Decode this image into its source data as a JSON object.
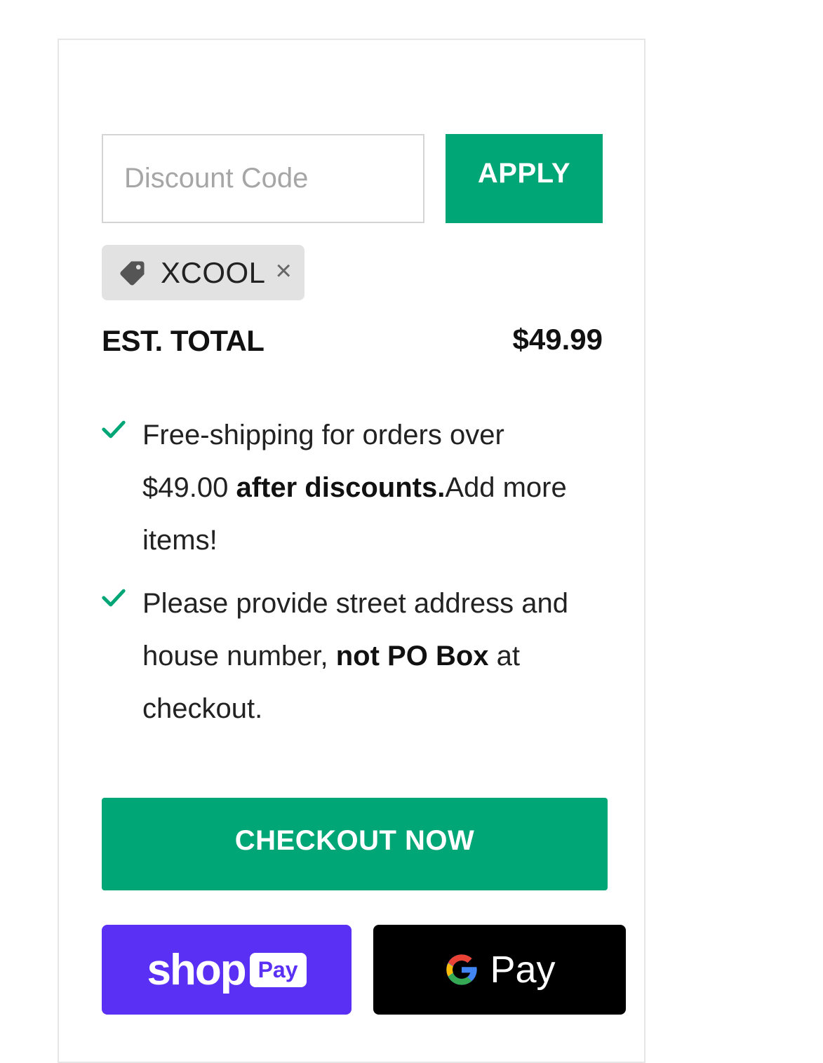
{
  "colors": {
    "accent": "#00a676",
    "shop_pay": "#5a31f4",
    "google_pay": "#000000"
  },
  "discount": {
    "placeholder": "Discount Code",
    "value": "",
    "apply_label": "APPLY"
  },
  "applied_code": {
    "icon": "tag-icon",
    "code": "XCOOL",
    "remove_symbol": "×"
  },
  "total": {
    "label": "EST. TOTAL",
    "value": "$49.99"
  },
  "notices": [
    {
      "icon": "check-icon",
      "part1": "Free-shipping for orders over $49.00 ",
      "bold": "after discounts.",
      "part2": "Add more items!"
    },
    {
      "icon": "check-icon",
      "part1": "Please provide street address and house number, ",
      "bold": "not PO Box",
      "part2": " at checkout."
    }
  ],
  "checkout": {
    "label": "CHECKOUT NOW"
  },
  "express": {
    "shop_pay": {
      "word": "shop",
      "badge": "Pay"
    },
    "google_pay": {
      "icon": "google-g-icon",
      "word": "Pay"
    }
  }
}
